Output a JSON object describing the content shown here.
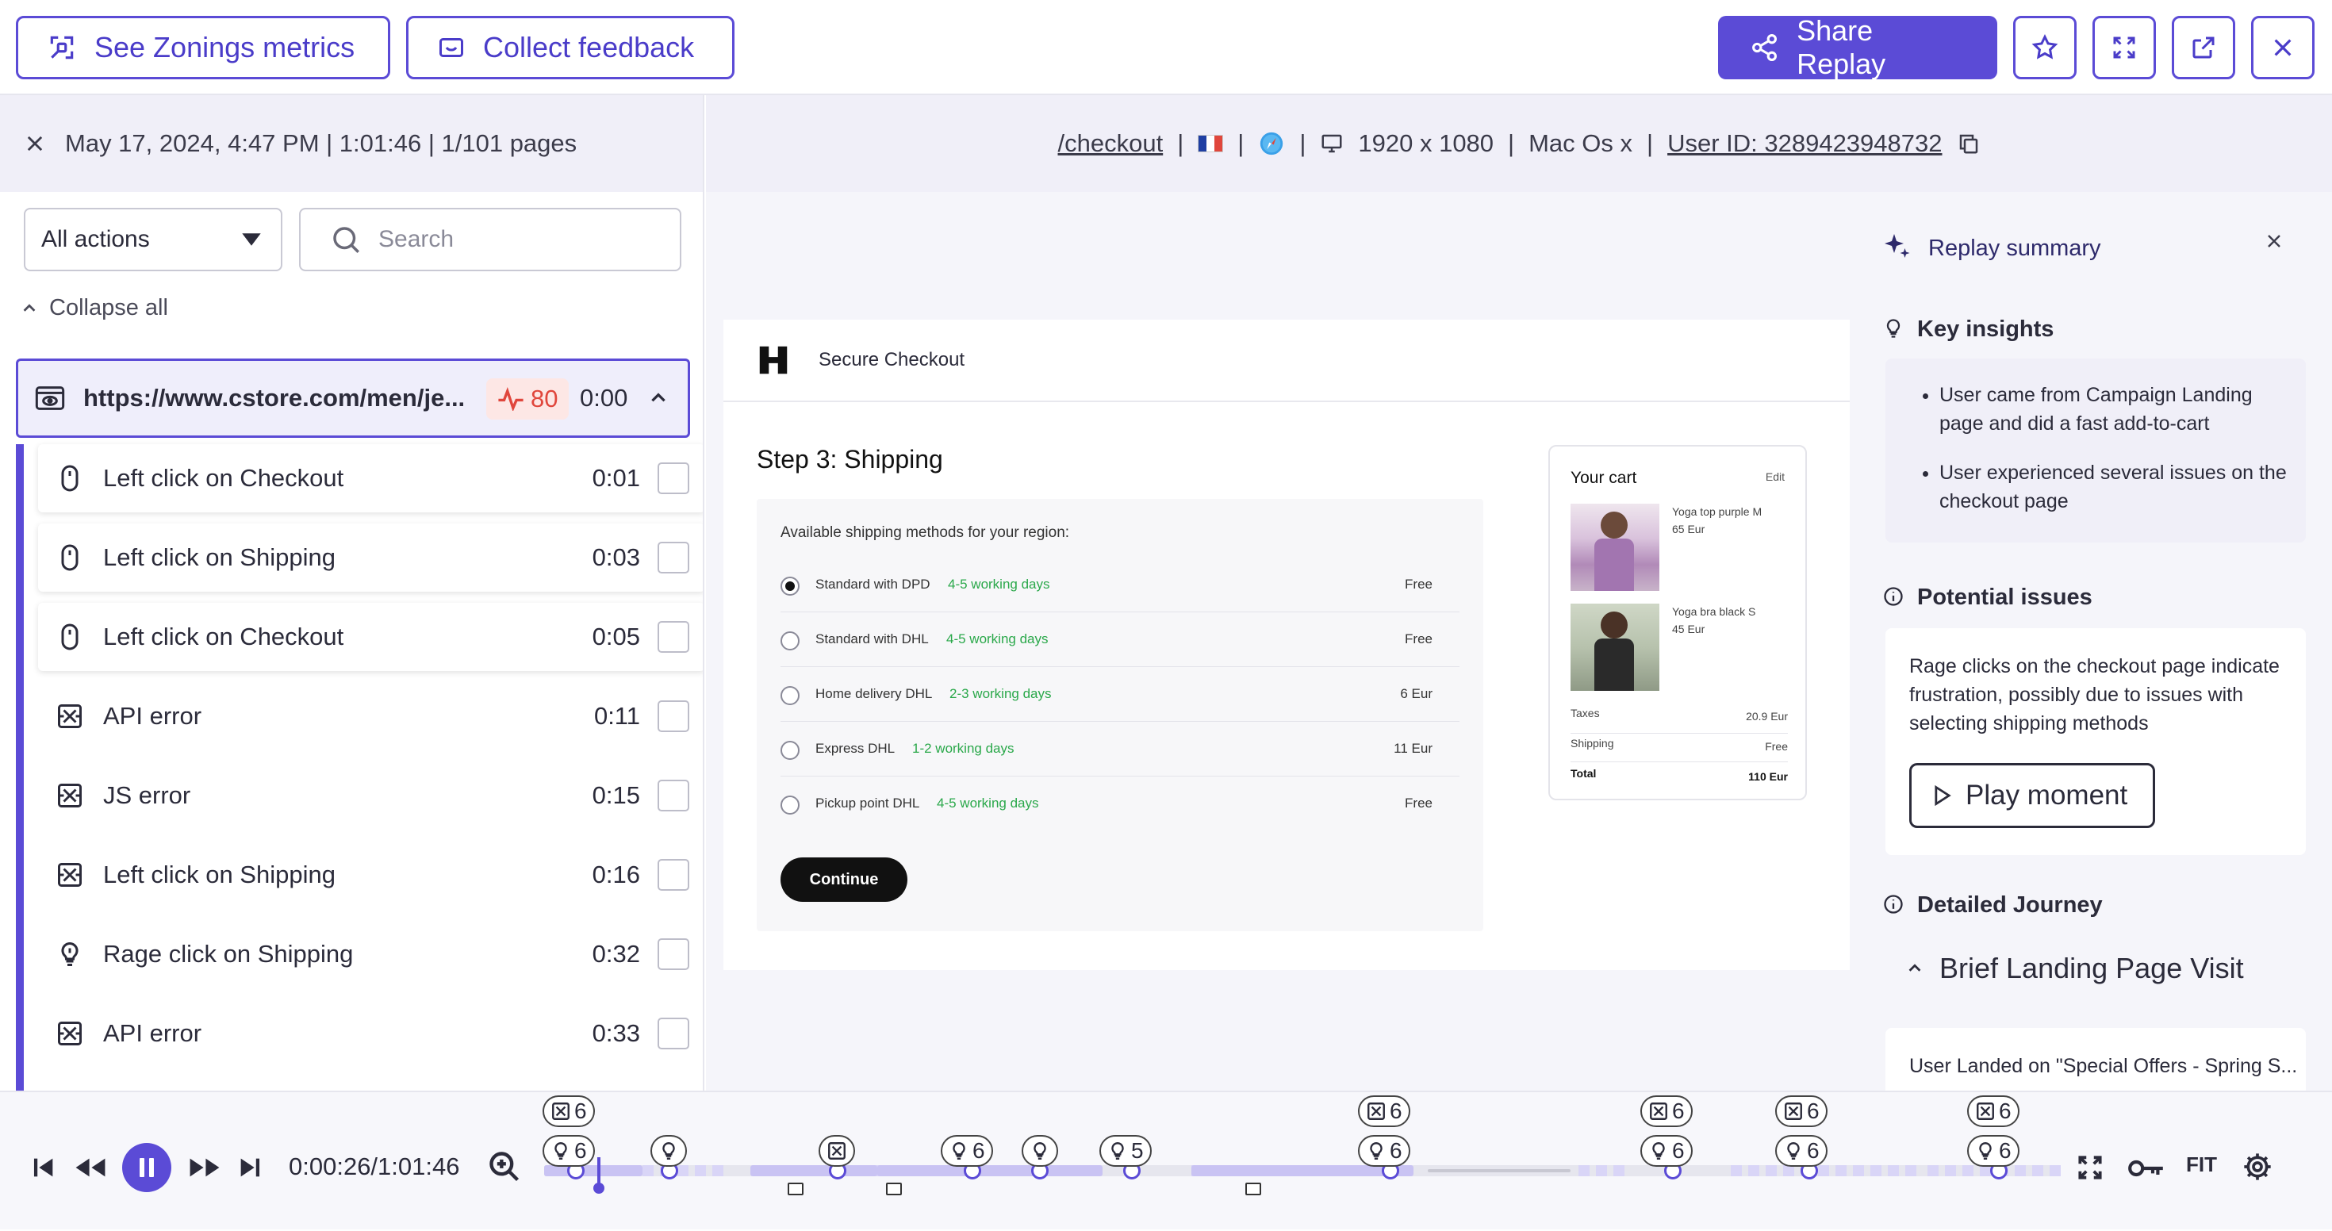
{
  "toolbar": {
    "zoning_label": "See Zonings metrics",
    "feedback_label": "Collect feedback",
    "share_label": "Share Replay"
  },
  "session": {
    "info": "May 17, 2024, 4:47 PM | 1:01:46 | 1/101 pages"
  },
  "filters": {
    "select_value": "All actions",
    "search_placeholder": "Search",
    "collapse_label": "Collapse all"
  },
  "url_row": {
    "url": "https://www.cstore.com/men/je...",
    "score": "80",
    "time": "0:00"
  },
  "events": [
    {
      "label": "Left click on Checkout",
      "time": "0:01",
      "icon": "mouse-icon"
    },
    {
      "label": "Left click on Shipping",
      "time": "0:03",
      "icon": "mouse-icon"
    },
    {
      "label": "Left click on Checkout",
      "time": "0:05",
      "icon": "mouse-icon"
    },
    {
      "label": "API error",
      "time": "0:11",
      "icon": "error-icon"
    },
    {
      "label": "JS error",
      "time": "0:15",
      "icon": "error-icon"
    },
    {
      "label": "Left click on Shipping",
      "time": "0:16",
      "icon": "error-icon"
    },
    {
      "label": "Rage click on Shipping",
      "time": "0:32",
      "icon": "rage-icon"
    },
    {
      "label": "API error",
      "time": "0:33",
      "icon": "error-icon"
    }
  ],
  "infobar": {
    "path": "/checkout",
    "resolution": "1920 x 1080",
    "os": "Mac Os x",
    "user_id": "User ID: 3289423948732"
  },
  "checkout": {
    "header": "Secure Checkout",
    "step_title": "Step 3: Shipping",
    "methods_label": "Available shipping methods for your region:",
    "methods": [
      {
        "name": "Standard with DPD",
        "days": "4-5 working days",
        "price": "Free",
        "selected": true
      },
      {
        "name": "Standard with DHL",
        "days": "4-5 working days",
        "price": "Free",
        "selected": false
      },
      {
        "name": "Home delivery DHL",
        "days": "2-3 working days",
        "price": "6 Eur",
        "selected": false
      },
      {
        "name": "Express DHL",
        "days": "1-2 working days",
        "price": "11 Eur",
        "selected": false
      },
      {
        "name": "Pickup point DHL",
        "days": "4-5 working days",
        "price": "Free",
        "selected": false
      }
    ],
    "continue_label": "Continue",
    "cart": {
      "title": "Your cart",
      "edit": "Edit",
      "items": [
        {
          "name": "Yoga top purple M",
          "price": "65 Eur"
        },
        {
          "name": "Yoga bra black S",
          "price": "45 Eur"
        }
      ],
      "taxes_label": "Taxes",
      "taxes_value": "20.9 Eur",
      "shipping_label": "Shipping",
      "shipping_value": "Free",
      "total_label": "Total",
      "total_value": "110 Eur"
    }
  },
  "summary": {
    "title": "Replay summary",
    "key_insights_title": "Key insights",
    "insights": [
      "User came from Campaign Landing page and did a fast add-to-cart",
      "User experienced several issues on the checkout page"
    ],
    "potential_issues_title": "Potential issues",
    "issue_text": "Rage clicks on the checkout page indicate frustration, possibly due to issues with selecting shipping methods",
    "play_moment_label": "Play moment",
    "journey_title": "Detailed Journey",
    "journey_section": "Brief Landing Page Visit",
    "journey_text": "User Landed on \"Special Offers - Spring S..."
  },
  "player": {
    "time": "0:00:26/1:01:46",
    "fit_label": "FIT",
    "progress": 0.026,
    "markers_top": [
      "6",
      "6",
      "6",
      "6",
      "6"
    ],
    "markers_bottom": [
      "6",
      "",
      "",
      "6",
      "",
      "5",
      "6",
      "6",
      "6",
      "6"
    ]
  },
  "colors": {
    "accent": "#5b4bd6",
    "green": "#2aa84a",
    "danger": "#e0463c"
  }
}
